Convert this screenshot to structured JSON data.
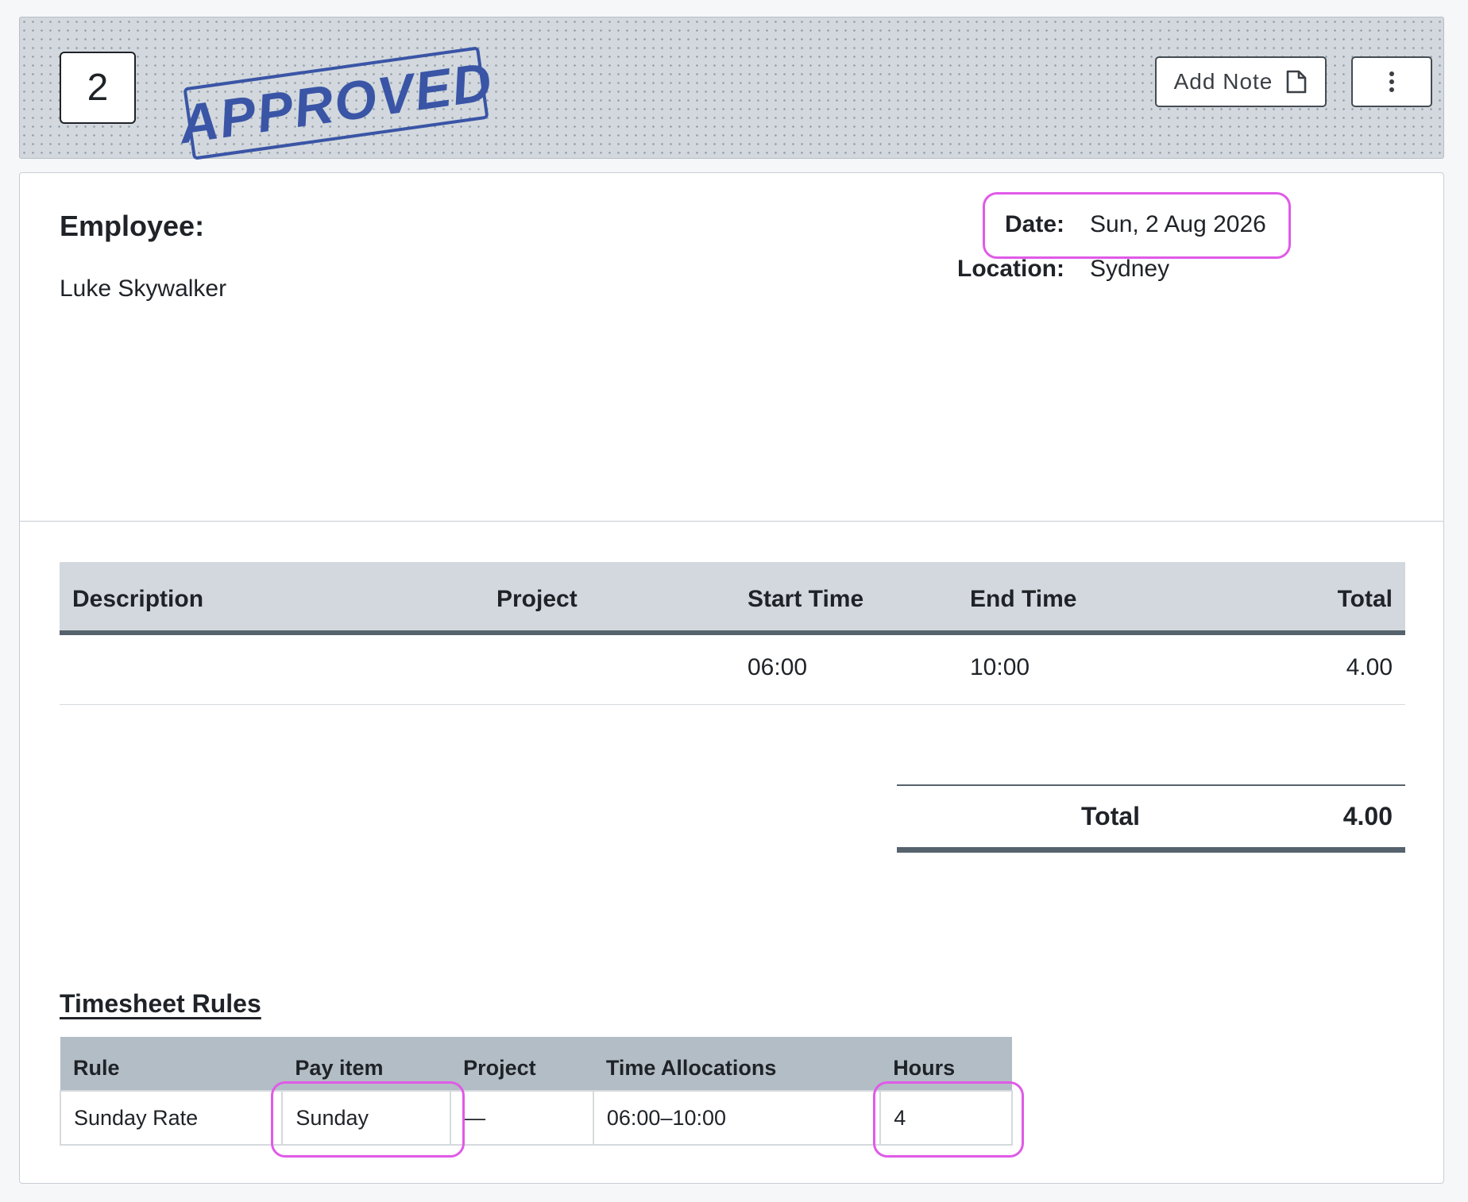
{
  "header": {
    "timesheet_number": "2",
    "status_stamp": "APPROVED",
    "add_note_label": "Add Note",
    "colors": {
      "stamp": "#3a55a6",
      "header_bg": "#d2d8dd"
    }
  },
  "details": {
    "employee_label": "Employee:",
    "employee_name": "Luke Skywalker",
    "date_label": "Date:",
    "date_value": "Sun, 2 Aug 2026",
    "location_label": "Location:",
    "location_value": "Sydney",
    "highlight_color": "#e05ae8"
  },
  "lines": {
    "columns": [
      "Description",
      "Project",
      "Start Time",
      "End Time",
      "Total"
    ],
    "rows": [
      {
        "description": "",
        "project": "",
        "start": "06:00",
        "end": "10:00",
        "total": "4.00"
      }
    ],
    "total_label": "Total",
    "total_value": "4.00"
  },
  "rules": {
    "title": "Timesheet Rules",
    "columns": [
      "Rule",
      "Pay item",
      "Project",
      "Time Allocations",
      "Hours"
    ],
    "rows": [
      {
        "rule": "Sunday Rate",
        "pay_item": "Sunday",
        "project": "—",
        "time_allocations": "06:00–10:00",
        "hours": "4"
      }
    ]
  }
}
